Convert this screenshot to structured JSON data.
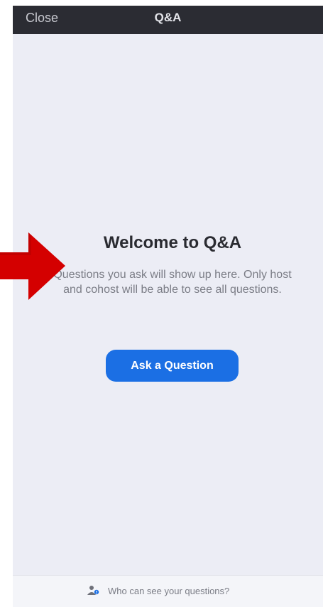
{
  "top_bar": {
    "close_label": "Close",
    "title": "Q&A"
  },
  "empty_state": {
    "title": "Welcome to Q&A",
    "body": "Questions you ask will show up here. Only host and cohost will be able to see all questions."
  },
  "ask_button": {
    "label": "Ask a Question"
  },
  "footer": {
    "text": "Who can see your questions?",
    "icon": "people-icon"
  },
  "annotation": {
    "icon": "red-arrow-icon",
    "color": "#d40000"
  },
  "colors": {
    "top_bar": "#2b2c33",
    "background": "#ecedf5",
    "accent": "#1b6fe4"
  }
}
